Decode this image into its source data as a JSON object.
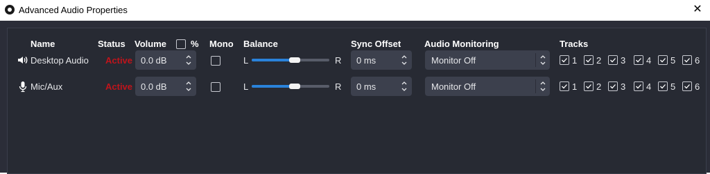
{
  "window": {
    "title": "Advanced Audio Properties",
    "close_glyph": "✕"
  },
  "headers": {
    "name": "Name",
    "status": "Status",
    "volume": "Volume",
    "percent": "%",
    "mono": "Mono",
    "balance": "Balance",
    "sync_offset": "Sync Offset",
    "audio_monitoring": "Audio Monitoring",
    "tracks": "Tracks"
  },
  "balance_labels": {
    "left": "L",
    "right": "R"
  },
  "rows": [
    {
      "icon": "speaker-icon",
      "name": "Desktop Audio",
      "status": "Active",
      "volume": "0.0 dB",
      "mono": false,
      "balance": 0.5,
      "sync_offset": "0 ms",
      "monitoring": "Monitor Off",
      "tracks": [
        "1",
        "2",
        "3",
        "4",
        "5",
        "6"
      ]
    },
    {
      "icon": "microphone-icon",
      "name": "Mic/Aux",
      "status": "Active",
      "volume": "0.0 dB",
      "mono": false,
      "balance": 0.5,
      "sync_offset": "0 ms",
      "monitoring": "Monitor Off",
      "tracks": [
        "1",
        "2",
        "3",
        "4",
        "5",
        "6"
      ]
    }
  ],
  "colors": {
    "status_active": "#c0141b",
    "slider_fill": "#2a82da",
    "panel_bg": "#272a33"
  }
}
